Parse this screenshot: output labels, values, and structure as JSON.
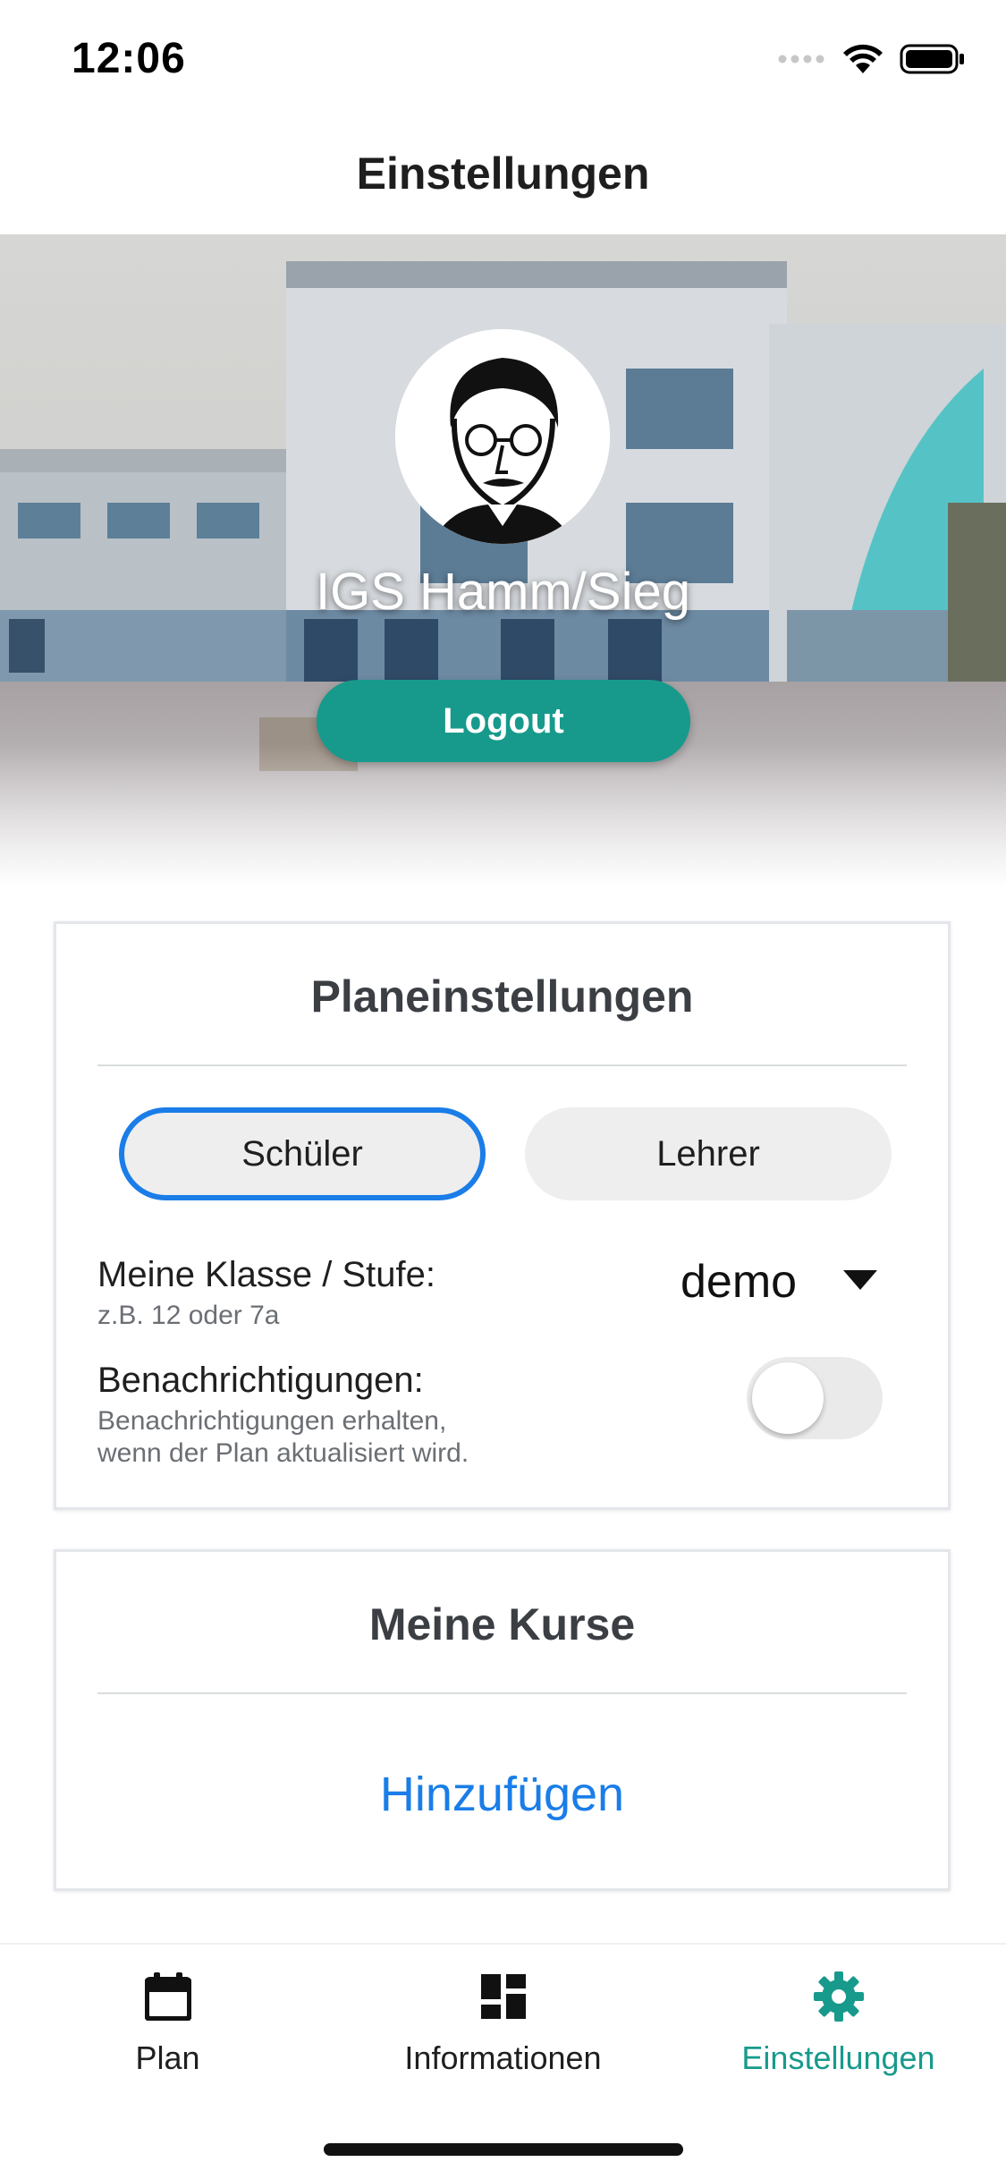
{
  "status_bar": {
    "time": "12:06"
  },
  "nav": {
    "title": "Einstellungen"
  },
  "profile": {
    "school_name": "IGS Hamm/Sieg",
    "logout_label": "Logout"
  },
  "plan_settings": {
    "title": "Planeinstellungen",
    "segments": [
      "Schüler",
      "Lehrer"
    ],
    "selected_segment": "Schüler",
    "class": {
      "label": "Meine Klasse / Stufe:",
      "hint": "z.B. 12 oder 7a",
      "value": "demo"
    },
    "notifications": {
      "label": "Benachrichtigungen:",
      "hint_line1": "Benachrichtigungen erhalten,",
      "hint_line2": "wenn der Plan aktualisiert wird.",
      "enabled": false
    }
  },
  "courses": {
    "title": "Meine Kurse",
    "add_label": "Hinzufügen"
  },
  "tabs": [
    {
      "label": "Plan",
      "icon": "calendar-icon",
      "active": false
    },
    {
      "label": "Informationen",
      "icon": "dashboard-icon",
      "active": false
    },
    {
      "label": "Einstellungen",
      "icon": "gear-icon",
      "active": true
    }
  ],
  "colors": {
    "accent": "#179a8c",
    "link": "#1a7de8",
    "selected_border": "#1a7de8"
  }
}
